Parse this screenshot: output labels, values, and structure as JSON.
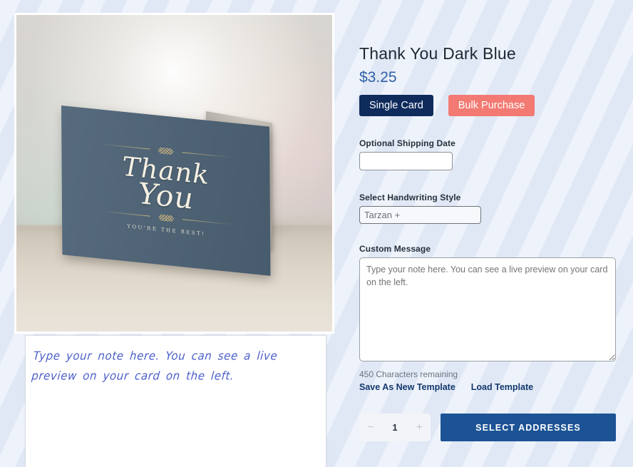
{
  "product": {
    "title": "Thank You Dark Blue",
    "price": "$3.25"
  },
  "purchase_modes": {
    "single_label": "Single Card",
    "bulk_label": "Bulk Purchase",
    "selected": "Single Card"
  },
  "card_preview": {
    "headline_line1": "Thank",
    "headline_line2": "You",
    "subtext": "YOU'RE THE BEST!",
    "card_color": "#4c6275",
    "ink_color": "#f5f0e2",
    "ornament_color": "#c9b480"
  },
  "note_preview": {
    "text": "Type your note here. You can see a live preview on your card on the left.",
    "ink_color": "#4a5fc8"
  },
  "form": {
    "shipping_date": {
      "label": "Optional Shipping Date",
      "value": "",
      "placeholder": ""
    },
    "handwriting_style": {
      "label": "Select Handwriting Style",
      "value": "Tarzan +"
    },
    "custom_message": {
      "label": "Custom Message",
      "value": "Type your note here. You can see a live preview on your card on the left.",
      "placeholder": "Type your note here. You can see a live preview on your card on the left."
    },
    "char_counter": "450 Characters remaining",
    "save_template_label": "Save As New Template",
    "load_template_label": "Load Template"
  },
  "actions": {
    "quantity": "1",
    "decrement_label": "−",
    "increment_label": "+",
    "select_addresses_label": "SELECT ADDRESSES"
  },
  "colors": {
    "navy": "#0e2b5c",
    "coral": "#f27a72",
    "link_navy": "#13386e",
    "price_blue": "#2f5fa8",
    "primary_button": "#1c5395",
    "page_background": "#eef3fb"
  }
}
